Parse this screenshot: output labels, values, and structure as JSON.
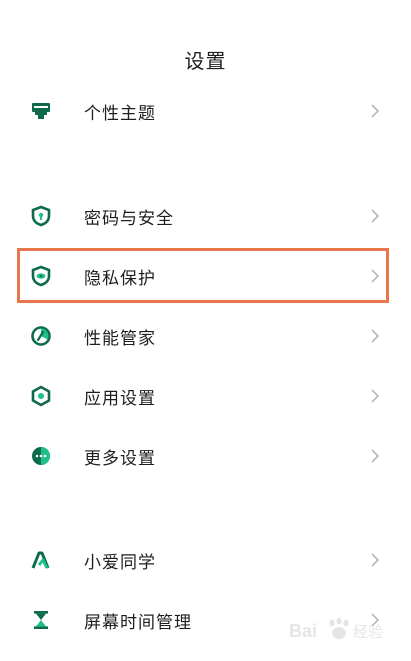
{
  "header": {
    "title": "设置"
  },
  "colors": {
    "accent": "#0d6b4b",
    "highlight_border": "#e8764b",
    "chevron": "#b8b8b8"
  },
  "settings_groups": [
    {
      "items": [
        {
          "label": "个性主题",
          "icon": "theme-icon"
        }
      ]
    },
    {
      "items": [
        {
          "label": "密码与安全",
          "icon": "shield-lock-icon"
        },
        {
          "label": "隐私保护",
          "icon": "privacy-shield-icon"
        },
        {
          "label": "性能管家",
          "icon": "performance-icon"
        },
        {
          "label": "应用设置",
          "icon": "app-settings-icon"
        },
        {
          "label": "更多设置",
          "icon": "more-settings-icon"
        }
      ]
    },
    {
      "items": [
        {
          "label": "小爱同学",
          "icon": "xiaoai-icon"
        },
        {
          "label": "屏幕时间管理",
          "icon": "hourglass-icon"
        }
      ]
    }
  ],
  "watermark": {
    "text": "Bai经验",
    "icon": "baidu-paw-icon"
  }
}
